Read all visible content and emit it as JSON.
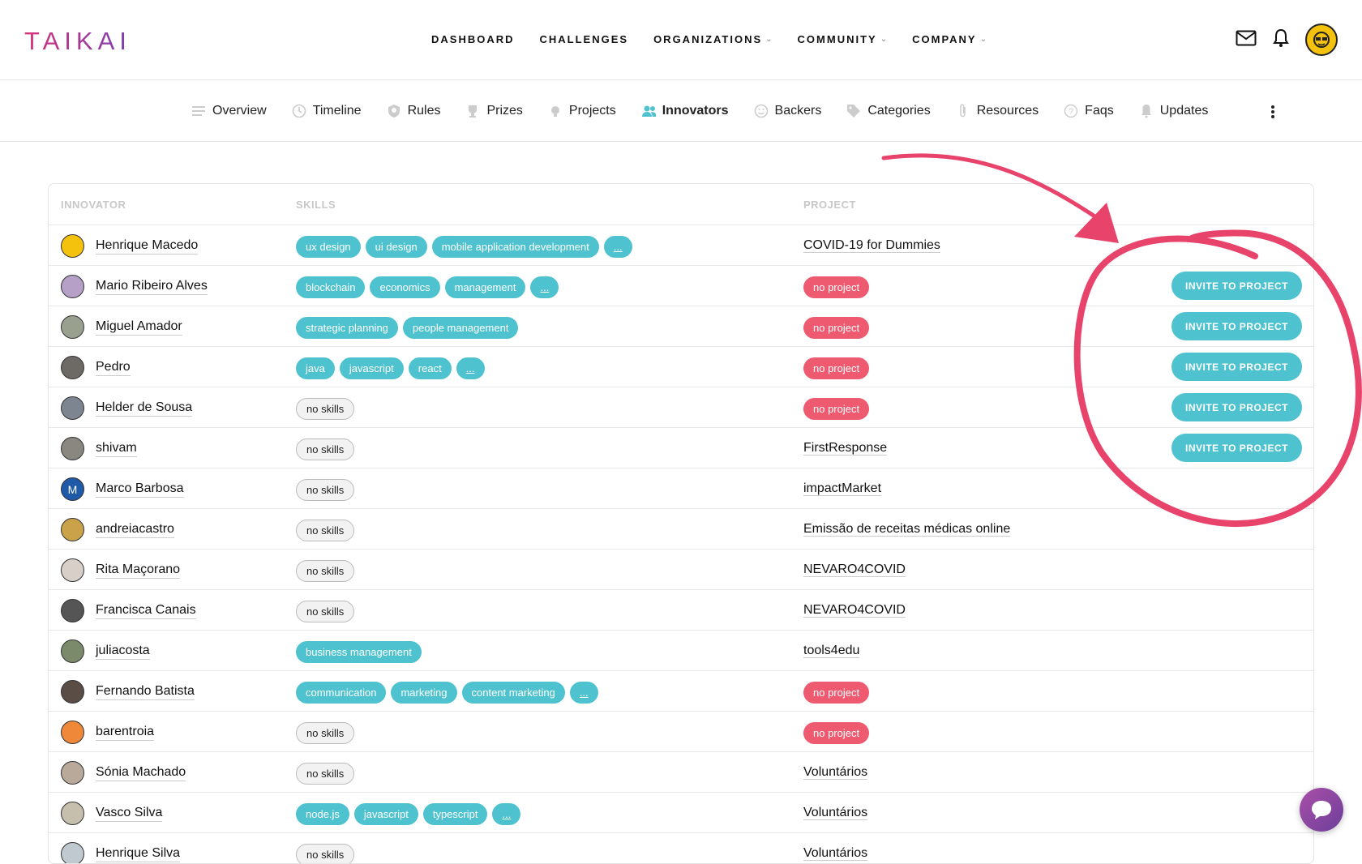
{
  "brand": {
    "logo_text": "TAIKAI"
  },
  "main_nav": [
    {
      "label": "DASHBOARD",
      "dropdown": false
    },
    {
      "label": "CHALLENGES",
      "dropdown": false
    },
    {
      "label": "ORGANIZATIONS",
      "dropdown": true
    },
    {
      "label": "COMMUNITY",
      "dropdown": true
    },
    {
      "label": "COMPANY",
      "dropdown": true
    }
  ],
  "tabs": [
    {
      "label": "Overview",
      "icon": "list-icon"
    },
    {
      "label": "Timeline",
      "icon": "clock-icon"
    },
    {
      "label": "Rules",
      "icon": "shield-icon"
    },
    {
      "label": "Prizes",
      "icon": "trophy-icon"
    },
    {
      "label": "Projects",
      "icon": "lightbulb-icon"
    },
    {
      "label": "Innovators",
      "icon": "users-icon",
      "active": true
    },
    {
      "label": "Backers",
      "icon": "smiley-icon"
    },
    {
      "label": "Categories",
      "icon": "tag-icon"
    },
    {
      "label": "Resources",
      "icon": "paperclip-icon"
    },
    {
      "label": "Faqs",
      "icon": "question-icon"
    },
    {
      "label": "Updates",
      "icon": "bell-icon"
    }
  ],
  "table": {
    "headers": {
      "innovator": "INNOVATOR",
      "skills": "SKILLS",
      "project": "PROJECT"
    },
    "invite_label": "INVITE TO PROJECT",
    "rows": [
      {
        "name": "Henrique Macedo",
        "avatar_color": "#f4c20d",
        "skills": [
          "ux design",
          "ui design",
          "mobile application development",
          "..."
        ],
        "project": "COVID-19 for Dummies",
        "invite": false
      },
      {
        "name": "Mario Ribeiro Alves",
        "avatar_color": "#b7a0c8",
        "skills": [
          "blockchain",
          "economics",
          "management",
          "..."
        ],
        "project": null,
        "invite": true
      },
      {
        "name": "Miguel Amador",
        "avatar_color": "#9aa08e",
        "skills": [
          "strategic planning",
          "people management"
        ],
        "project": null,
        "invite": true
      },
      {
        "name": "Pedro",
        "avatar_color": "#6d6a66",
        "skills": [
          "java",
          "javascript",
          "react",
          "..."
        ],
        "project": null,
        "invite": true
      },
      {
        "name": "Helder de Sousa",
        "avatar_color": "#7c8590",
        "skills": [],
        "project": null,
        "invite": true
      },
      {
        "name": "shivam",
        "avatar_color": "#8a8680",
        "skills": [],
        "project": "FirstResponse",
        "invite": true
      },
      {
        "name": "Marco Barbosa",
        "avatar_color": "#1e5aa8",
        "avatar_letter": "M",
        "skills": [],
        "project": "impactMarket",
        "invite": false
      },
      {
        "name": "andreiacastro",
        "avatar_color": "#c9a24a",
        "skills": [],
        "project": "Emissão de receitas médicas online",
        "invite": false
      },
      {
        "name": "Rita Maçorano",
        "avatar_color": "#d8cfc8",
        "skills": [],
        "project": "NEVARO4COVID",
        "invite": false
      },
      {
        "name": "Francisca Canais",
        "avatar_color": "#555",
        "skills": [],
        "project": "NEVARO4COVID",
        "invite": false
      },
      {
        "name": "juliacosta",
        "avatar_color": "#7a8a6a",
        "skills": [
          "business management"
        ],
        "project": "tools4edu",
        "invite": false
      },
      {
        "name": "Fernando Batista",
        "avatar_color": "#5a4d46",
        "skills": [
          "communication",
          "marketing",
          "content marketing",
          "..."
        ],
        "project": null,
        "invite": false
      },
      {
        "name": "barentroia",
        "avatar_color": "#f0883a",
        "skills": [],
        "project": null,
        "invite": false
      },
      {
        "name": "Sónia Machado",
        "avatar_color": "#b9a99a",
        "skills": [],
        "project": "Voluntários",
        "invite": false
      },
      {
        "name": "Vasco Silva",
        "avatar_color": "#c6bfae",
        "skills": [
          "node.js",
          "javascript",
          "typescript",
          "..."
        ],
        "project": "Voluntários",
        "invite": false
      },
      {
        "name": "Henrique Silva",
        "avatar_color": "#c0c8d0",
        "skills": [],
        "project": "Voluntários",
        "invite": false
      }
    ],
    "no_skills_label": "no skills",
    "no_project_label": "no project"
  },
  "colors": {
    "accent": "#4fc2cf",
    "no_project": "#ee5a6f",
    "annotation": "#e8436a"
  }
}
